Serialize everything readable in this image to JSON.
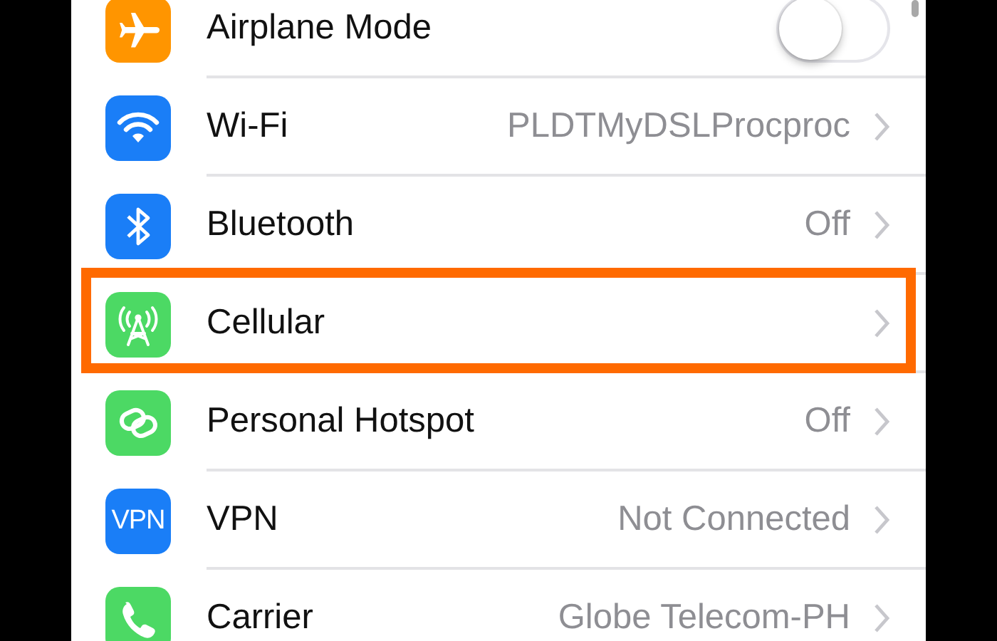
{
  "settings": [
    {
      "label": "Airplane Mode",
      "kind": "toggle",
      "on": false,
      "color": "#ff9500",
      "highlighted": false
    },
    {
      "label": "Wi-Fi",
      "kind": "link",
      "value": "PLDTMyDSLProcproc",
      "color": "#1a7ef7",
      "highlighted": false
    },
    {
      "label": "Bluetooth",
      "kind": "link",
      "value": "Off",
      "color": "#1a7ef7",
      "highlighted": false
    },
    {
      "label": "Cellular",
      "kind": "link",
      "color": "#4cd964",
      "highlighted": true
    },
    {
      "label": "Personal Hotspot",
      "kind": "link",
      "value": "Off",
      "color": "#4cd964",
      "highlighted": false
    },
    {
      "label": "VPN",
      "kind": "link",
      "value": "Not Connected",
      "color": "#1a7ef7",
      "badge": "VPN",
      "highlighted": false
    },
    {
      "label": "Carrier",
      "kind": "link",
      "value": "Globe Telecom-PH",
      "color": "#4cd964",
      "highlighted": false
    }
  ]
}
